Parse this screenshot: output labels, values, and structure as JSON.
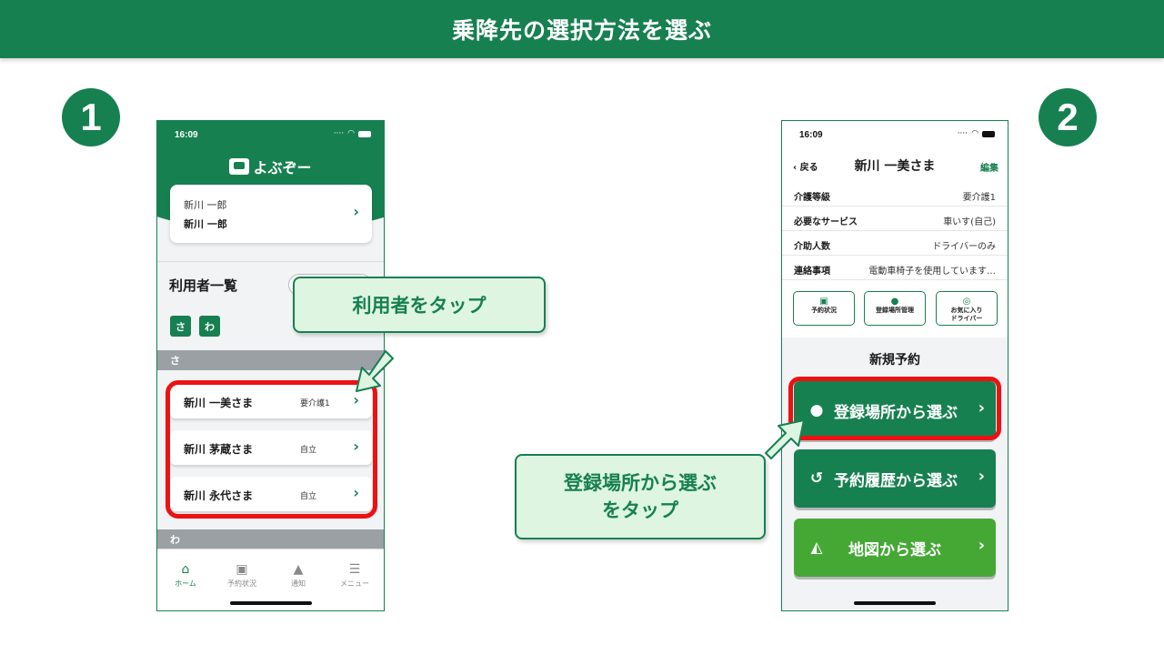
{
  "slide": {
    "title": "乗降先の選択方法を選ぶ",
    "step1": "1",
    "step2": "2",
    "callout1": "利用者をタップ",
    "callout2_line1": "登録場所から選ぶ",
    "callout2_line2": "をタップ"
  },
  "colors": {
    "brand": "#178050",
    "highlight": "#ee1111",
    "callout_bg": "#def5e2",
    "map_button": "#45a835"
  },
  "phone1": {
    "time": "16:09",
    "logo": "よぶぞー",
    "account": {
      "line1": "新川 一郎",
      "line2": "新川 一郎"
    },
    "list_title": "利用者一覧",
    "kana_buttons": [
      "さ",
      "わ"
    ],
    "sections": [
      "さ",
      "わ"
    ],
    "users": [
      {
        "name": "新川 一美さま",
        "care": "要介護1"
      },
      {
        "name": "新川 茅蔵さま",
        "care": "自立"
      },
      {
        "name": "新川 永代さま",
        "care": "自立"
      }
    ],
    "tabs": [
      {
        "label": "ホーム",
        "icon": "home-icon"
      },
      {
        "label": "予約状況",
        "icon": "car-icon"
      },
      {
        "label": "通知",
        "icon": "bell-icon"
      },
      {
        "label": "メニュー",
        "icon": "menu-icon"
      }
    ]
  },
  "phone2": {
    "time": "16:09",
    "back": "戻る",
    "title": "新川 一美さま",
    "edit": "編集",
    "info": [
      {
        "key": "介護等級",
        "value": "要介護1"
      },
      {
        "key": "必要なサービス",
        "value": "車いす(自己)"
      },
      {
        "key": "介助人数",
        "value": "ドライバーのみ"
      },
      {
        "key": "連絡事項",
        "value": "電動車椅子を使用しています…"
      }
    ],
    "quick": [
      {
        "label": "予約状況",
        "icon": "car-icon"
      },
      {
        "label": "登録場所管理",
        "icon": "pin-icon"
      },
      {
        "label": "お気に入り",
        "label2": "ドライバー",
        "icon": "steering-wheel-icon"
      }
    ],
    "section_title": "新規予約",
    "buttons": [
      {
        "label": "登録場所から選ぶ",
        "icon": "pin-icon"
      },
      {
        "label": "予約履歴から選ぶ",
        "icon": "history-icon"
      },
      {
        "label": "地図から選ぶ",
        "icon": "map-icon"
      }
    ]
  }
}
